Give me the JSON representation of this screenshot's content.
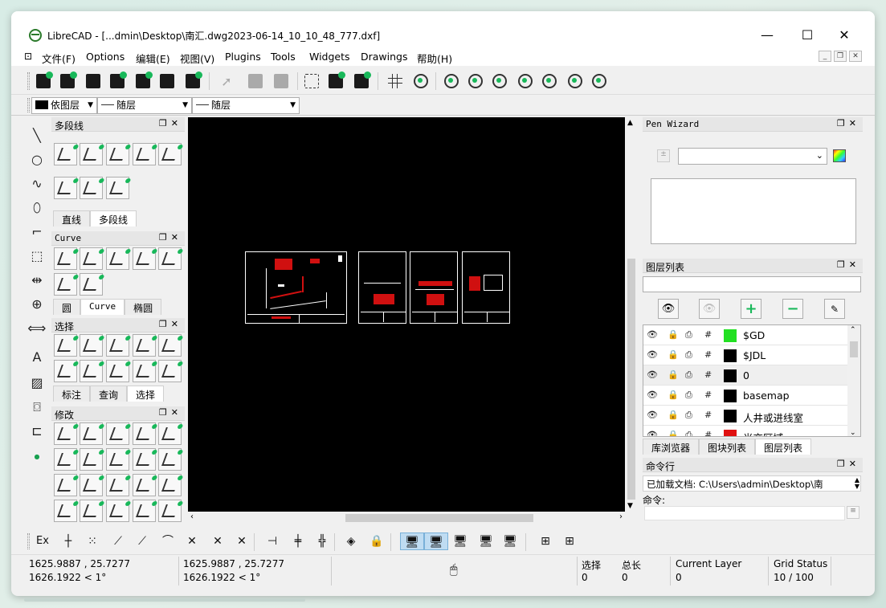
{
  "window": {
    "title": "LibreCAD - [...dmin\\Desktop\\南汇.dwg2023-06-14_10_10_48_777.dxf]",
    "minimize": "—",
    "maximize": "☐",
    "close": "✕"
  },
  "menu": {
    "items": [
      "文件(F)",
      "Options",
      "编辑(E)",
      "视图(V)",
      "Plugins",
      "Tools",
      "Widgets",
      "Drawings",
      "帮助(H)"
    ],
    "mdi_min": "_",
    "mdi_restore": "❐",
    "mdi_close": "✕"
  },
  "toolbar2": {
    "color": "依图层",
    "linewidth": "随层",
    "linetype": "随层"
  },
  "panels": {
    "polyline": {
      "title": "多段线",
      "tabs": [
        "直线",
        "多段线"
      ]
    },
    "curve": {
      "title": "Curve",
      "tabs": [
        "圆",
        "Curve",
        "椭圆"
      ]
    },
    "select": {
      "title": "选择",
      "tabs": [
        "标注",
        "查询",
        "选择"
      ]
    },
    "modify": {
      "title": "修改"
    }
  },
  "pen_wizard": {
    "title": "Pen Wizard"
  },
  "layers": {
    "title": "图层列表",
    "search_placeholder": "",
    "rows": [
      {
        "name": "$GD",
        "color": "#22e022"
      },
      {
        "name": "$JDL",
        "color": "#000000"
      },
      {
        "name": "0",
        "color": "#000000"
      },
      {
        "name": "basemap",
        "color": "#000000"
      },
      {
        "name": "人井或进线室",
        "color": "#000000"
      },
      {
        "name": "光交区域",
        "color": "#e01010"
      }
    ],
    "tabs": [
      "库浏览器",
      "图块列表",
      "图层列表"
    ]
  },
  "command": {
    "title": "命令行",
    "history": "已加载文档: C:\\Users\\admin\\Desktop\\南",
    "prompt": "命令:"
  },
  "bottom_toolbar": {
    "ex_label": "Ex"
  },
  "status": {
    "abs_coord": "1625.9887 , 25.7277",
    "abs_polar": "1626.1922 < 1°",
    "rel_coord": "1625.9887 , 25.7277",
    "rel_polar": "1626.1922 < 1°",
    "selected_label": "选择",
    "selected_value": "0",
    "total_label": "总长",
    "total_value": "0",
    "current_layer_label": "Current Layer",
    "current_layer_value": "0",
    "grid_label": "Grid Status",
    "grid_value": "10 / 100"
  }
}
